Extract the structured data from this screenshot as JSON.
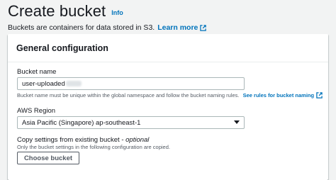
{
  "header": {
    "title": "Create bucket",
    "info_link": "Info",
    "subtitle": "Buckets are containers for data stored in S3.",
    "learn_more": "Learn more"
  },
  "panel": {
    "title": "General configuration",
    "bucket_name": {
      "label": "Bucket name",
      "value": "user-uploaded",
      "description": "Bucket name must be unique within the global namespace and follow the bucket naming rules.",
      "rules_link": "See rules for bucket naming"
    },
    "region": {
      "label": "AWS Region",
      "selected": "Asia Pacific (Singapore) ap-southeast-1"
    },
    "copy_settings": {
      "label": "Copy settings from existing bucket - ",
      "optional": "optional",
      "description": "Only the bucket settings in the following configuration are copied.",
      "button": "Choose bucket"
    }
  },
  "colors": {
    "link": "#0073bb",
    "background": "#f2f3f3",
    "text": "#16191f",
    "muted": "#545b64"
  }
}
